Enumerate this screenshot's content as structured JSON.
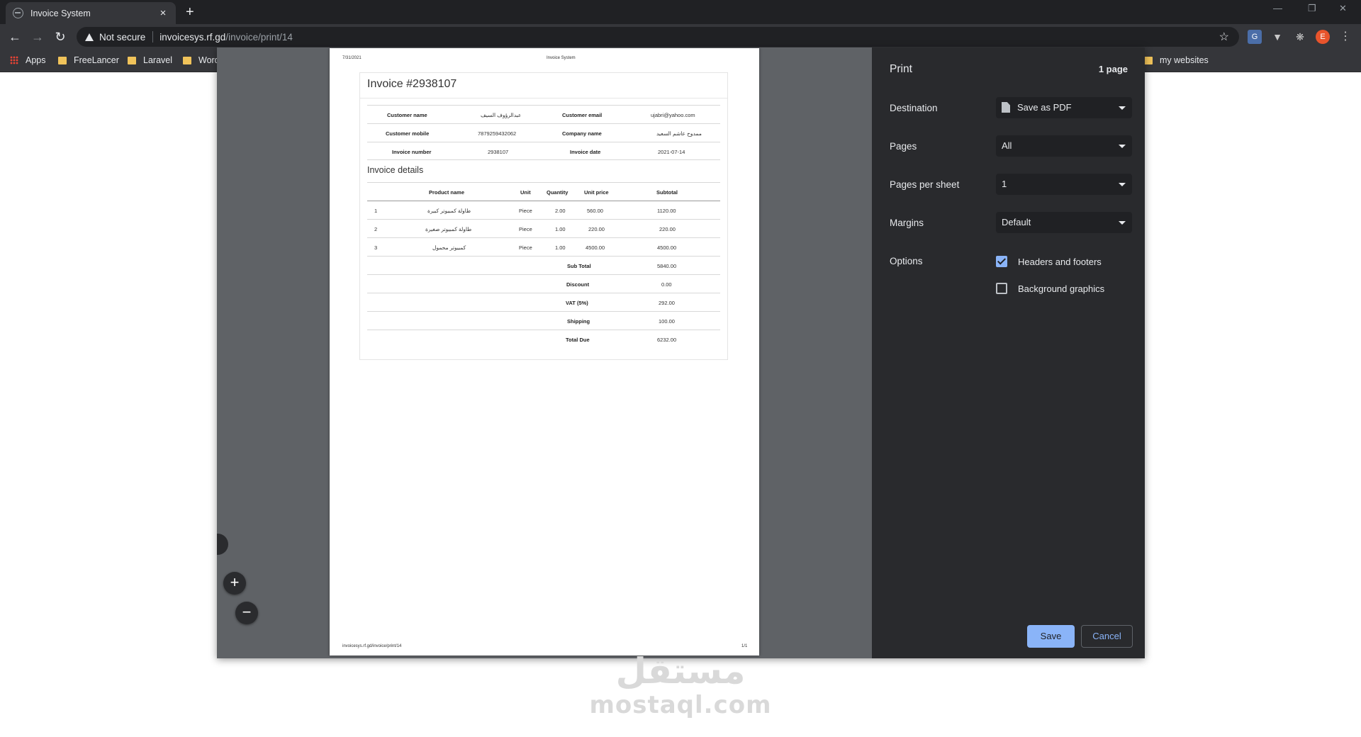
{
  "browser": {
    "tab_title": "Invoice System",
    "tab_close": "×",
    "new_tab": "+",
    "not_secure": "Not secure",
    "url_host": "invoicesys.rf.gd",
    "url_path": "/invoice/print/14",
    "profile_initial": "E",
    "bookmarks": [
      "Apps",
      "FreeLancer",
      "Laravel",
      "Word",
      "my websites"
    ]
  },
  "print": {
    "title": "Print",
    "page_count": "1 page",
    "destination_label": "Destination",
    "destination_value": "Save as PDF",
    "pages_label": "Pages",
    "pages_value": "All",
    "per_sheet_label": "Pages per sheet",
    "per_sheet_value": "1",
    "margins_label": "Margins",
    "margins_value": "Default",
    "options_label": "Options",
    "headers_footers": "Headers and footers",
    "headers_footers_checked": true,
    "background_graphics": "Background graphics",
    "background_graphics_checked": false,
    "save": "Save",
    "cancel": "Cancel"
  },
  "paper": {
    "header_date": "7/31/2021",
    "header_title": "Invoice System",
    "footer_url": "invoicesys.rf.gd/invoice/print/14",
    "footer_page": "1/1"
  },
  "invoice": {
    "title": "Invoice #2938107",
    "info": [
      {
        "l1": "Customer name",
        "v1": "عبدالرؤوف السيف",
        "l2": "Customer email",
        "v2": "ujabri@yahoo.com"
      },
      {
        "l1": "Customer mobile",
        "v1": "7879259432062",
        "l2": "Company name",
        "v2": "ممدوح عاشم السعيد"
      },
      {
        "l1": "Invoice number",
        "v1": "2938107",
        "l2": "Invoice date",
        "v2": "2021-07-14"
      }
    ],
    "details_title": "Invoice details",
    "columns": {
      "product": "Product name",
      "unit": "Unit",
      "qty": "Quantity",
      "price": "Unit price",
      "subtotal": "Subtotal"
    },
    "items": [
      {
        "n": "1",
        "product": "طاولة كمبيوتر كبيرة",
        "unit": "Piece",
        "qty": "2.00",
        "price": "560.00",
        "subtotal": "1120.00"
      },
      {
        "n": "2",
        "product": "طاولة كمبيوتر صغيرة",
        "unit": "Piece",
        "qty": "1.00",
        "price": "220.00",
        "subtotal": "220.00"
      },
      {
        "n": "3",
        "product": "كمبيوتر محمول",
        "unit": "Piece",
        "qty": "1.00",
        "price": "4500.00",
        "subtotal": "4500.00"
      }
    ],
    "totals": [
      {
        "label": "Sub Total",
        "value": "5840.00"
      },
      {
        "label": "Discount",
        "value": "0.00"
      },
      {
        "label": "VAT (5%)",
        "value": "292.00"
      },
      {
        "label": "Shipping",
        "value": "100.00"
      },
      {
        "label": "Total Due",
        "value": "6232.00"
      }
    ]
  },
  "watermark": {
    "arabic": "مستقل",
    "latin": "mostaql.com"
  },
  "colors": {
    "accent": "#8ab4f8",
    "dialog_bg": "#292a2d",
    "chrome_bg": "#35363a"
  }
}
